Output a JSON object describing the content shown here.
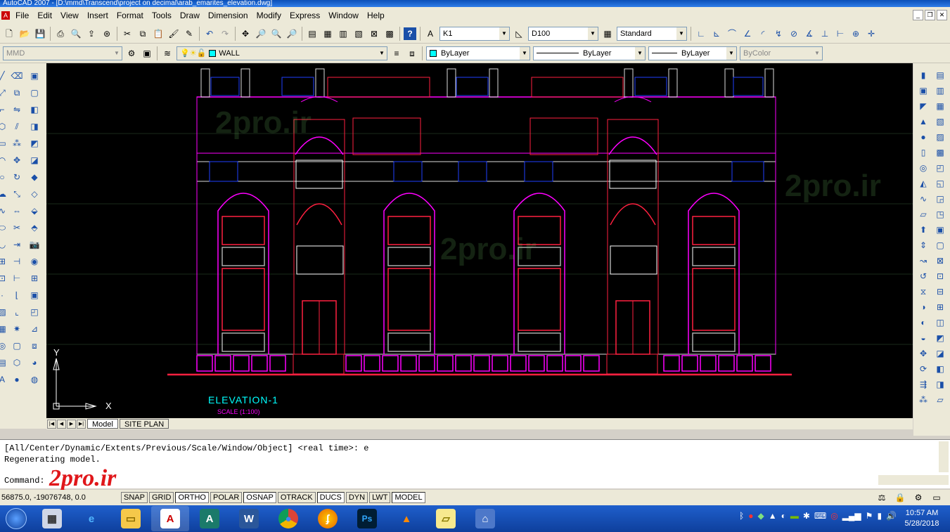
{
  "window": {
    "title": "AutoCAD 2007 - [D:\\mmd\\Transcend\\project on decimal\\arab_emarites_elevation.dwg]"
  },
  "menu": [
    "File",
    "Edit",
    "View",
    "Insert",
    "Format",
    "Tools",
    "Draw",
    "Dimension",
    "Modify",
    "Express",
    "Window",
    "Help"
  ],
  "toolbar": {
    "text_style": "K1",
    "dim_style": "D100",
    "table_style": "Standard",
    "workspace": "MMD",
    "layer": "WALL",
    "color": "ByLayer",
    "linetype": "ByLayer",
    "lineweight": "ByLayer",
    "plotstyle": "ByColor"
  },
  "drawing": {
    "title": "ELEVATION-1",
    "scale": "SCALE (1:100)",
    "axis_x": "X",
    "axis_y": "Y"
  },
  "tabs": [
    "Model",
    "SITE PLAN"
  ],
  "command": {
    "line1": "[All/Center/Dynamic/Extents/Previous/Scale/Window/Object] <real time>: e",
    "line2": "Regenerating model.",
    "prompt": "Command:"
  },
  "status": {
    "coords": "56875.0, -19076748, 0.0",
    "buttons": [
      "SNAP",
      "GRID",
      "ORTHO",
      "POLAR",
      "OSNAP",
      "OTRACK",
      "DUCS",
      "DYN",
      "LWT",
      "MODEL"
    ]
  },
  "watermark": "2pro.ir",
  "taskbar": {
    "time": "10:57 AM",
    "date": "5/28/2018"
  },
  "icons": {
    "taskbar_apps": [
      "calculator-icon",
      "internet-explorer-icon",
      "file-explorer-icon",
      "autocad-icon",
      "autocad-architecture-icon",
      "word-icon",
      "chrome-icon",
      "firefox-icon",
      "photoshop-icon",
      "vlc-icon",
      "sticky-notes-icon",
      "network-app-icon"
    ]
  }
}
